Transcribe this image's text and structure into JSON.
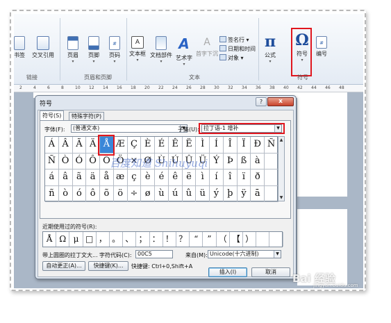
{
  "ribbon": {
    "buttons": [
      {
        "id": "bookmark",
        "label": "书签",
        "icon": "bookmark-icon"
      },
      {
        "id": "cross_ref",
        "label": "交叉引用",
        "icon": "cross-reference-icon"
      },
      {
        "id": "header",
        "label": "页眉",
        "icon": "header-icon"
      },
      {
        "id": "footer",
        "label": "页脚",
        "icon": "footer-icon"
      },
      {
        "id": "page_number",
        "label": "页码",
        "icon": "page-number-icon"
      },
      {
        "id": "textbox",
        "label": "文本框",
        "icon": "textbox-icon"
      },
      {
        "id": "quick_parts",
        "label": "文档部件",
        "icon": "quick-parts-icon"
      },
      {
        "id": "wordart",
        "label": "艺术字",
        "icon": "wordart-icon"
      },
      {
        "id": "dropcap",
        "label": "首字下沉",
        "icon": "dropcap-icon"
      },
      {
        "id": "equation",
        "label": "公式",
        "icon": "pi-icon"
      },
      {
        "id": "symbol",
        "label": "符号",
        "icon": "omega-icon"
      },
      {
        "id": "numbering",
        "label": "编号",
        "icon": "numbering-icon"
      }
    ],
    "small_items": {
      "signature": "签名行",
      "datetime": "日期和时间",
      "object": "对象"
    },
    "groups": {
      "links": "链接",
      "header_footer": "页眉和页脚",
      "text": "文本",
      "symbols": "符号"
    }
  },
  "ruler": {
    "ticks": [
      "2",
      "4",
      "6",
      "8",
      "10",
      "12",
      "14",
      "16",
      "18",
      "20",
      "22",
      "24",
      "26",
      "28",
      "30",
      "32",
      "34",
      "36",
      "38",
      "40",
      "42",
      "44",
      "46",
      "48"
    ]
  },
  "dialog": {
    "title": "符号",
    "help": "?",
    "close": "x",
    "tabs": [
      "符号(S)",
      "特殊字符(P)"
    ],
    "font_label": "字体(F):",
    "font_value": "(普通文本)",
    "subset_label": "子集(U):",
    "subset_value": "拉丁语-1 增补",
    "grid": [
      [
        "Á",
        "Â",
        "Ã",
        "Ä",
        "Å",
        "Æ",
        "Ç",
        "È",
        "É",
        "Ê",
        "Ë",
        "Ì",
        "Í",
        "Î",
        "Ï",
        "Ð",
        "Ñ"
      ],
      [
        "Ñ",
        "Ò",
        "Ó",
        "Ô",
        "Õ",
        "Ö",
        "×",
        "Ø",
        "Ù",
        "Ú",
        "Û",
        "Ü",
        "Ý",
        "Þ",
        "ß",
        "à",
        ""
      ],
      [
        "á",
        "â",
        "ã",
        "ä",
        "å",
        "æ",
        "ç",
        "è",
        "é",
        "ê",
        "ë",
        "ì",
        "í",
        "î",
        "ï",
        "ð",
        ""
      ],
      [
        "ñ",
        "ò",
        "ó",
        "ô",
        "õ",
        "ö",
        "÷",
        "ø",
        "ù",
        "ú",
        "û",
        "ü",
        "ý",
        "þ",
        "ÿ",
        "ā",
        ""
      ]
    ],
    "selected_char": "Å",
    "watermark": "百度知道 Shihuyuqi",
    "recent_label": "近期使用过的符号(R):",
    "recent": [
      "Å",
      "Ω",
      "μ",
      "□",
      "，",
      "。",
      "、",
      "；",
      "：",
      "！",
      "？",
      "“",
      "”",
      "（",
      "【",
      "）",
      "",
      ""
    ],
    "char_name": "带上圆圈的拉丁文大...",
    "charcode_label": "字符代码(C):",
    "charcode_value": "00C5",
    "from_label": "来自(M):",
    "from_value": "Unicode(十六进制)",
    "autocorrect_button": "自动更正(A)...",
    "shortcut_button": "快捷键(K)...",
    "shortcut_info": "快捷键: Ctrl+0,Shift+A",
    "insert_button": "插入(I)",
    "cancel_button": "取消"
  },
  "site_watermark": {
    "brand": "Bai 经验",
    "sub": "jingyan.baidu.com"
  },
  "colors": {
    "highlight": "#e0161e",
    "selection": "#3a86d8"
  }
}
